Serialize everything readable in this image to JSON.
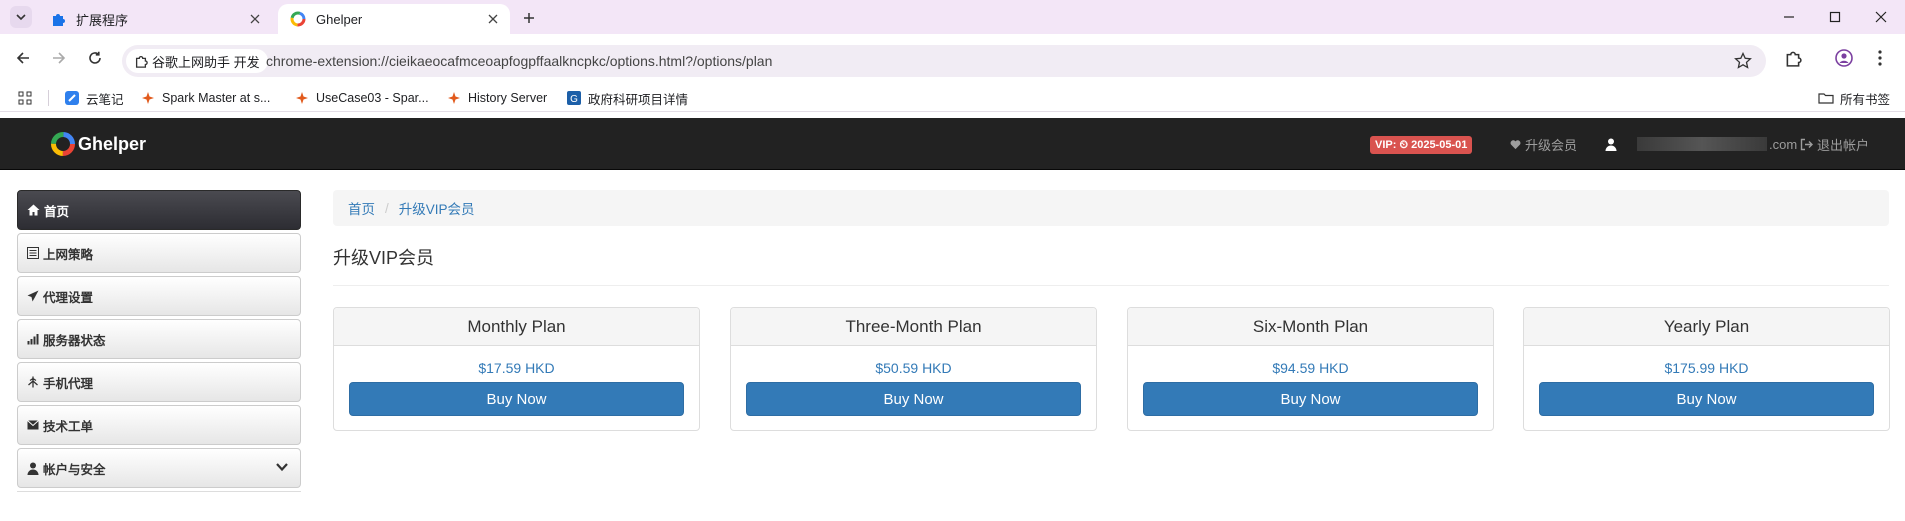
{
  "browser": {
    "tabs": [
      {
        "title": "扩展程序",
        "active": false
      },
      {
        "title": "Ghelper",
        "active": true
      }
    ],
    "omnibox": {
      "site_chip": "谷歌上网助手 开发",
      "url": "chrome-extension://cieikaeocafmceoapfogpffaalkncpkc/options.html?/options/plan"
    },
    "bookmarks": [
      {
        "label": "云笔记",
        "icon": "note-icon"
      },
      {
        "label": "Spark Master at s...",
        "icon": "spark-icon"
      },
      {
        "label": "UseCase03 - Spar...",
        "icon": "spark-icon"
      },
      {
        "label": "History Server",
        "icon": "spark-icon"
      },
      {
        "label": "政府科研项目详情",
        "icon": "gov-icon"
      }
    ],
    "all_bookmarks": "所有书签"
  },
  "navbar": {
    "brand": "Ghelper",
    "vip_badge": "VIP: ⏲ 2025-05-01",
    "upgrade": "升级会员",
    "account_suffix": ".com",
    "logout": "退出帐户"
  },
  "sidebar": {
    "items": [
      {
        "label": "首页",
        "icon": "home-icon",
        "active": true
      },
      {
        "label": "上网策略",
        "icon": "list-icon"
      },
      {
        "label": "代理设置",
        "icon": "send-icon"
      },
      {
        "label": "服务器状态",
        "icon": "signal-icon"
      },
      {
        "label": "手机代理",
        "icon": "phone-icon"
      },
      {
        "label": "技术工单",
        "icon": "envelope-icon"
      },
      {
        "label": "帐户与安全",
        "icon": "user-icon",
        "has_dropdown": true
      }
    ]
  },
  "breadcrumb": {
    "home": "首页",
    "current": "升级VIP会员"
  },
  "page_title": "升级VIP会员",
  "plans": [
    {
      "name": "Monthly Plan",
      "price": "$17.59 HKD",
      "button": "Buy Now"
    },
    {
      "name": "Three-Month Plan",
      "price": "$50.59 HKD",
      "button": "Buy Now"
    },
    {
      "name": "Six-Month Plan",
      "price": "$94.59 HKD",
      "button": "Buy Now"
    },
    {
      "name": "Yearly Plan",
      "price": "$175.99 HKD",
      "button": "Buy Now"
    }
  ],
  "colors": {
    "primary": "#337ab7",
    "navbar": "#222222",
    "vip": "#d9534f",
    "chrome": "#f3e6f7"
  }
}
